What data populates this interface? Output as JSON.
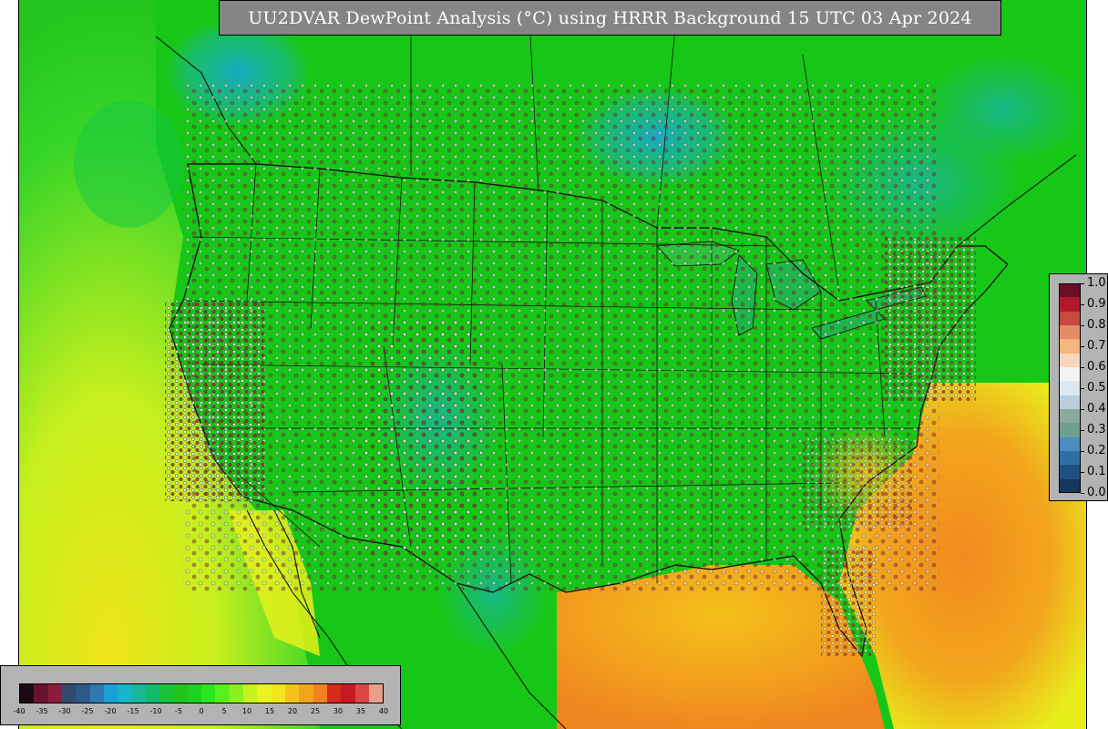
{
  "title": "UU2DVAR DewPoint Analysis (°C) using HRRR Background 15 UTC 03 Apr 2024",
  "colorbar": {
    "ticks": [
      "-40",
      "-35",
      "-30",
      "-25",
      "-20",
      "-15",
      "-10",
      "-5",
      "0",
      "5",
      "10",
      "15",
      "20",
      "25",
      "30",
      "35",
      "40"
    ],
    "colors": [
      "#1b0a14",
      "#6b1232",
      "#8c1b3c",
      "#324a6e",
      "#2a5a8a",
      "#2f79b0",
      "#1a9fd4",
      "#18b4c8",
      "#1ab59a",
      "#14b86a",
      "#19c23a",
      "#22c41a",
      "#20d020",
      "#2be61e",
      "#58ef1c",
      "#8cf020",
      "#c6f21e",
      "#e9f41c",
      "#f2e61a",
      "#f5c21a",
      "#f4a31d",
      "#f1821f",
      "#d62a1e",
      "#c41a24",
      "#d94744",
      "#e8a08a"
    ]
  },
  "obs_legend": {
    "ticks": [
      "1.0",
      "0.9",
      "0.8",
      "0.7",
      "0.6",
      "0.5",
      "0.4",
      "0.3",
      "0.2",
      "0.1",
      "0.0"
    ],
    "colors": [
      "#6a0d25",
      "#b2182b",
      "#c84a3f",
      "#e58b66",
      "#f5b57c",
      "#f8d6bd",
      "#f3f3f3",
      "#dce7ef",
      "#b8cedd",
      "#8aa89e",
      "#6f9f8e",
      "#4b8cc4",
      "#2f6fa8",
      "#1f5084",
      "#15385e"
    ]
  },
  "colors": {
    "land_green": "#16c819",
    "ocean_cold": "#1ad35a",
    "ocean_warm": "#f2a21d",
    "dry_blue": "#1aa6c4",
    "border": "#000000"
  }
}
